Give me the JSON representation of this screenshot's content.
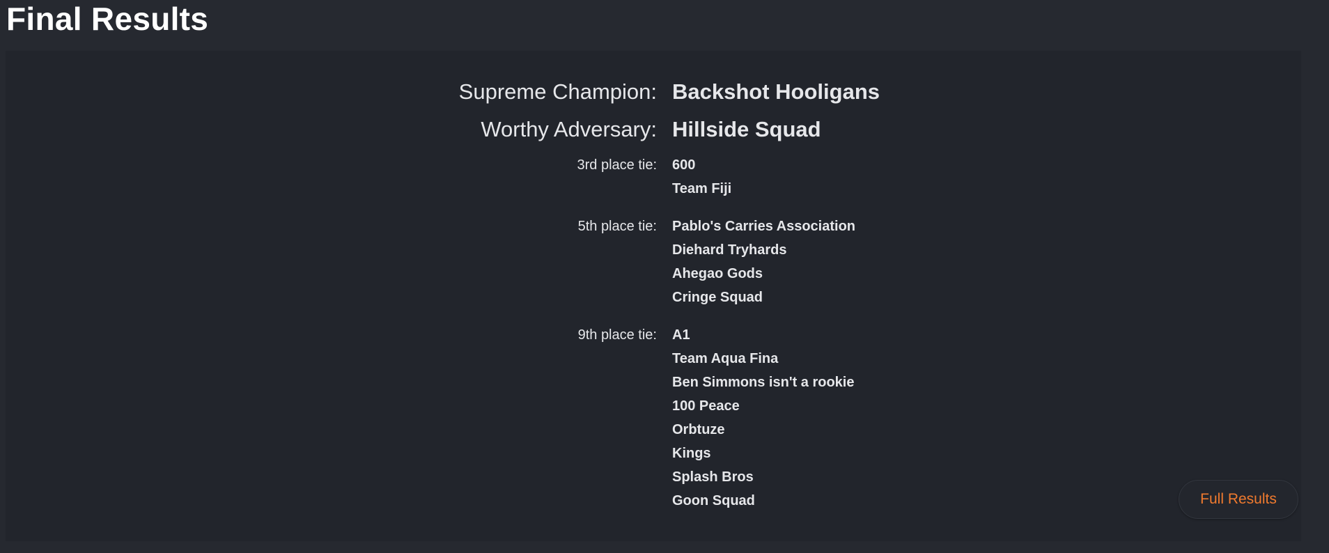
{
  "page": {
    "title": "Final Results"
  },
  "results": {
    "champion": {
      "label": "Supreme Champion:",
      "team": "Backshot Hooligans"
    },
    "runner_up": {
      "label": "Worthy Adversary:",
      "team": "Hillside Squad"
    },
    "third": {
      "label": "3rd place tie:",
      "teams": [
        "600",
        "Team Fiji"
      ]
    },
    "fifth": {
      "label": "5th place tie:",
      "teams": [
        "Pablo's Carries Association",
        "Diehard Tryhards",
        "Ahegao Gods",
        "Cringe Squad"
      ]
    },
    "ninth": {
      "label": "9th place tie:",
      "teams": [
        "A1",
        "Team Aqua Fina",
        "Ben Simmons isn't a rookie",
        "100 Peace",
        "Orbtuze",
        "Kings",
        "Splash Bros",
        "Goon Squad"
      ]
    }
  },
  "actions": {
    "full_results_label": "Full Results"
  },
  "colors": {
    "page_background": "#262930",
    "panel_background": "#22252c",
    "text": "#e6e7ea",
    "accent": "#f07a2e"
  }
}
